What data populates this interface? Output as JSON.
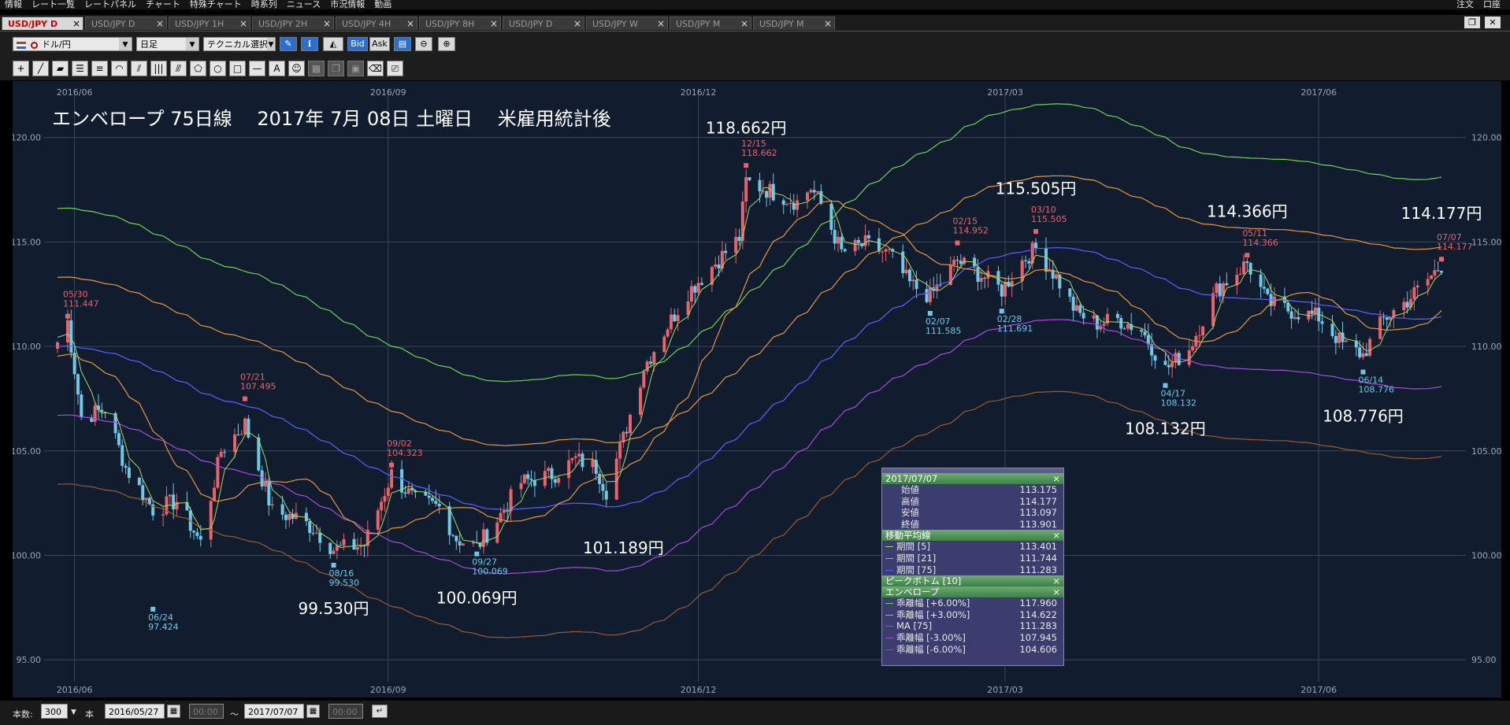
{
  "menubar": {
    "items": [
      "情報",
      "レート一覧",
      "レートパネル",
      "チャート",
      "特殊チャート",
      "時系列",
      "ニュース",
      "市況情報",
      "動画"
    ],
    "right_items": [
      "注文",
      "口座"
    ]
  },
  "tabs": [
    "USD/JPY D",
    "USD/JPY D",
    "USD/JPY 1H",
    "USD/JPY 2H",
    "USD/JPY 4H",
    "USD/JPY 8H",
    "USD/JPY D",
    "USD/JPY W",
    "USD/JPY M",
    "USD/JPY M"
  ],
  "toolbar": {
    "currency": "ドル/円",
    "timeframe": "日足",
    "technical": "テクニカル選択",
    "bid": "Bid",
    "ask": "Ask"
  },
  "bottom": {
    "count_label": "本数:",
    "count_value": "300",
    "unit": "本",
    "start_date": "2016/05/27",
    "start_time": "00:00",
    "tilde": "〜",
    "end_date": "2017/07/07",
    "end_time": "00:00"
  },
  "colors": {
    "bg": "#111d2f",
    "up": "#e8636a",
    "down": "#6ec8e8",
    "ma5": "#a6d86e",
    "ma21": "#e8963c",
    "ma75": "#5a62ff",
    "env_p6": "#6ed254",
    "env_p3": "#e8963c",
    "env_m3": "#a64cde",
    "env_m6": "#9a5a2e",
    "high_label": "#e8636a",
    "low_label": "#6ec8e8"
  },
  "chart_data": {
    "type": "candlestick",
    "title": "エンベロープ 75日線　 2017年 7月 08日 土曜日　 米雇用統計後",
    "x_ticks": [
      "2016/06",
      "2016/09",
      "2016/12",
      "2017/03",
      "2017/06"
    ],
    "x_range": [
      "2016/05/27",
      "2017/07/07"
    ],
    "y_ticks": [
      95.0,
      100.0,
      105.0,
      110.0,
      115.0,
      120.0
    ],
    "y_tick_labels": [
      "95.00",
      "100.00",
      "105.00",
      "110.00",
      "115.00",
      "120.00"
    ],
    "ylim": [
      93.2,
      122.7
    ],
    "grid": true,
    "peaks": [
      {
        "date": "05/30",
        "value": "111.447",
        "type": "high",
        "x_date": "2016-05-30"
      },
      {
        "date": "07/21",
        "value": "107.495",
        "type": "high",
        "x_date": "2016-07-21"
      },
      {
        "date": "09/02",
        "value": "104.323",
        "type": "high",
        "x_date": "2016-09-02"
      },
      {
        "date": "12/15",
        "value": "118.662",
        "type": "high",
        "x_date": "2016-12-15"
      },
      {
        "date": "02/15",
        "value": "114.952",
        "type": "high",
        "x_date": "2017-02-15"
      },
      {
        "date": "03/10",
        "value": "115.505",
        "type": "high",
        "x_date": "2017-03-10"
      },
      {
        "date": "05/11",
        "value": "114.366",
        "type": "high",
        "x_date": "2017-05-11"
      },
      {
        "date": "07/07",
        "value": "114.177",
        "type": "high",
        "x_date": "2017-07-07"
      },
      {
        "date": "06/24",
        "value": "97.424",
        "type": "low",
        "x_date": "2016-06-24"
      },
      {
        "date": "08/16",
        "value": "99.530",
        "type": "low",
        "x_date": "2016-08-16"
      },
      {
        "date": "09/27",
        "value": "100.069",
        "type": "low",
        "x_date": "2016-09-27"
      },
      {
        "date": "02/07",
        "value": "111.585",
        "type": "low",
        "x_date": "2017-02-07"
      },
      {
        "date": "02/28",
        "value": "111.691",
        "type": "low",
        "x_date": "2017-02-28"
      },
      {
        "date": "04/17",
        "value": "108.132",
        "type": "low",
        "x_date": "2017-04-17"
      },
      {
        "date": "06/14",
        "value": "108.776",
        "type": "low",
        "x_date": "2017-06-14"
      }
    ],
    "annotations": [
      {
        "text": "118.662円",
        "x_date": "2016-12-15",
        "y": 120.2
      },
      {
        "text": "115.505円",
        "x_date": "2017-03-10",
        "y": 117.3
      },
      {
        "text": "114.366円",
        "x_date": "2017-05-11",
        "y": 116.2
      },
      {
        "text": "114.177円",
        "x_date": "2017-07-07",
        "y": 116.1
      },
      {
        "text": "99.530円",
        "x_date": "2016-08-16",
        "y": 97.2
      },
      {
        "text": "100.069円",
        "x_date": "2016-09-27",
        "y": 97.7
      },
      {
        "text": "101.189円",
        "x_date": "2016-11-09",
        "y": 100.1
      },
      {
        "text": "108.132円",
        "x_date": "2017-04-17",
        "y": 105.8
      },
      {
        "text": "108.776円",
        "x_date": "2017-06-14",
        "y": 106.4
      }
    ],
    "price_anchors": [
      [
        "2016-05-27",
        110.2
      ],
      [
        "2016-05-30",
        111.2
      ],
      [
        "2016-06-03",
        106.6
      ],
      [
        "2016-06-10",
        107.0
      ],
      [
        "2016-06-16",
        104.2
      ],
      [
        "2016-06-24",
        102.2
      ],
      [
        "2016-07-01",
        102.6
      ],
      [
        "2016-07-08",
        100.6
      ],
      [
        "2016-07-14",
        105.0
      ],
      [
        "2016-07-21",
        106.3
      ],
      [
        "2016-07-29",
        102.1
      ],
      [
        "2016-08-05",
        101.8
      ],
      [
        "2016-08-10",
        101.3
      ],
      [
        "2016-08-16",
        100.3
      ],
      [
        "2016-08-25",
        100.5
      ],
      [
        "2016-09-02",
        103.9
      ],
      [
        "2016-09-09",
        102.6
      ],
      [
        "2016-09-16",
        102.3
      ],
      [
        "2016-09-21",
        100.8
      ],
      [
        "2016-09-27",
        100.4
      ],
      [
        "2016-10-03",
        101.7
      ],
      [
        "2016-10-10",
        103.5
      ],
      [
        "2016-10-20",
        103.9
      ],
      [
        "2016-10-26",
        104.6
      ],
      [
        "2016-11-01",
        104.2
      ],
      [
        "2016-11-04",
        103.1
      ],
      [
        "2016-11-09",
        105.6
      ],
      [
        "2016-11-15",
        109.0
      ],
      [
        "2016-11-22",
        111.0
      ],
      [
        "2016-11-28",
        112.6
      ],
      [
        "2016-12-06",
        114.0
      ],
      [
        "2016-12-13",
        115.2
      ],
      [
        "2016-12-15",
        117.9
      ],
      [
        "2016-12-21",
        117.5
      ],
      [
        "2016-12-30",
        116.9
      ],
      [
        "2017-01-03",
        117.6
      ],
      [
        "2017-01-06",
        116.8
      ],
      [
        "2017-01-12",
        114.5
      ],
      [
        "2017-01-19",
        114.9
      ],
      [
        "2017-01-26",
        114.4
      ],
      [
        "2017-02-01",
        113.0
      ],
      [
        "2017-02-07",
        112.4
      ],
      [
        "2017-02-15",
        114.1
      ],
      [
        "2017-02-22",
        113.4
      ],
      [
        "2017-02-28",
        112.7
      ],
      [
        "2017-03-06",
        114.1
      ],
      [
        "2017-03-10",
        114.7
      ],
      [
        "2017-03-16",
        113.3
      ],
      [
        "2017-03-22",
        111.6
      ],
      [
        "2017-03-28",
        111.1
      ],
      [
        "2017-04-03",
        111.3
      ],
      [
        "2017-04-10",
        110.8
      ],
      [
        "2017-04-17",
        108.9
      ],
      [
        "2017-04-24",
        109.9
      ],
      [
        "2017-05-02",
        112.7
      ],
      [
        "2017-05-11",
        114.0
      ],
      [
        "2017-05-17",
        112.1
      ],
      [
        "2017-05-24",
        111.7
      ],
      [
        "2017-06-01",
        111.4
      ],
      [
        "2017-06-08",
        110.1
      ],
      [
        "2017-06-14",
        109.6
      ],
      [
        "2017-06-20",
        111.3
      ],
      [
        "2017-06-27",
        112.2
      ],
      [
        "2017-07-03",
        113.2
      ],
      [
        "2017-07-07",
        113.9
      ]
    ]
  },
  "info_panel": {
    "date": "2017/07/07",
    "ohlc": [
      {
        "label": "始値",
        "value": "113.175"
      },
      {
        "label": "高値",
        "value": "114.177"
      },
      {
        "label": "安値",
        "value": "113.097"
      },
      {
        "label": "終値",
        "value": "113.901"
      }
    ],
    "ma_title": "移動平均線",
    "ma": [
      {
        "label": "期間 [5]",
        "value": "113.401",
        "color": "#a6d86e"
      },
      {
        "label": "期間 [21]",
        "value": "111.744",
        "color": "#e8963c"
      },
      {
        "label": "期間 [75]",
        "value": "111.283",
        "color": "#5a62ff"
      }
    ],
    "peak_title": "ピークボトム [10]",
    "env_title": "エンベロープ",
    "env": [
      {
        "label": "乖離幅 [+6.00%]",
        "value": "117.960",
        "color": "#6ed254"
      },
      {
        "label": "乖離幅 [+3.00%]",
        "value": "114.622",
        "color": "#e8963c"
      },
      {
        "label": "MA [75]",
        "value": "111.283",
        "color": "#5a62ff"
      },
      {
        "label": "乖離幅 [-3.00%]",
        "value": "107.945",
        "color": "#a64cde"
      },
      {
        "label": "乖離幅 [-6.00%]",
        "value": "104.606",
        "color": "#9a5a2e"
      }
    ],
    "close": "×"
  }
}
